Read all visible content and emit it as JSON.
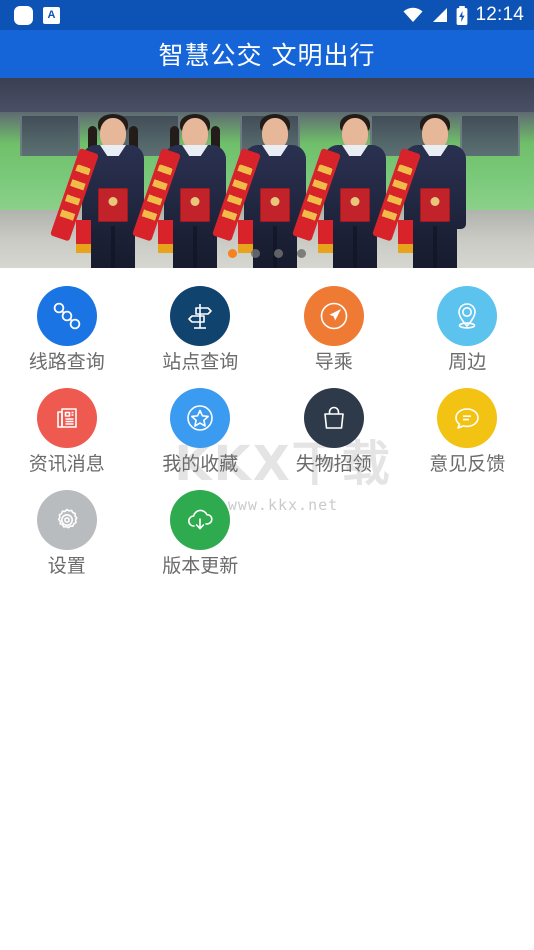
{
  "status_bar": {
    "left_icons": [
      {
        "name": "app-square-icon",
        "glyph": "rounded-square"
      },
      {
        "name": "keyboard-a-icon",
        "label": "A"
      }
    ],
    "right_icons": [
      {
        "name": "wifi-icon"
      },
      {
        "name": "signal-icon"
      },
      {
        "name": "battery-charging-icon"
      }
    ],
    "time": "12:14",
    "background": "#0d52b5"
  },
  "header": {
    "title": "智慧公交 文明出行",
    "background": "#1565d8",
    "text_color": "#ffffff"
  },
  "banner": {
    "alt": "五位身穿深蓝色制服、佩戴红色绶带的公交员工手持红色荣誉证书，站在绿色公交车前合影",
    "dots_total": 4,
    "active_dot": 1,
    "active_color": "#f5821f",
    "inactive_color": "#6e6e6e"
  },
  "grid": {
    "items": [
      {
        "label": "线路查询",
        "icon": "route-nodes-icon",
        "color": "#1b74e4"
      },
      {
        "label": "站点查询",
        "icon": "signpost-icon",
        "color": "#11436f"
      },
      {
        "label": "导乘",
        "icon": "navigation-arrow-icon",
        "color": "#ef7a34"
      },
      {
        "label": "周边",
        "icon": "location-pin-icon",
        "color": "#5cc2ee"
      },
      {
        "label": "资讯消息",
        "icon": "newspaper-icon",
        "color": "#ef5a50"
      },
      {
        "label": "我的收藏",
        "icon": "star-circle-icon",
        "color": "#3b9bf0"
      },
      {
        "label": "失物招领",
        "icon": "handbag-icon",
        "color": "#2e3a4a"
      },
      {
        "label": "意见反馈",
        "icon": "chat-bubble-icon",
        "color": "#f2c313"
      },
      {
        "label": "设置",
        "icon": "gear-icon",
        "color": "#b9bcbf"
      },
      {
        "label": "版本更新",
        "icon": "cloud-download-icon",
        "color": "#2fab4f"
      }
    ],
    "label_color": "#6b6b6b"
  },
  "watermark": {
    "big": "KKX下载",
    "small": "www.kkx.net"
  }
}
